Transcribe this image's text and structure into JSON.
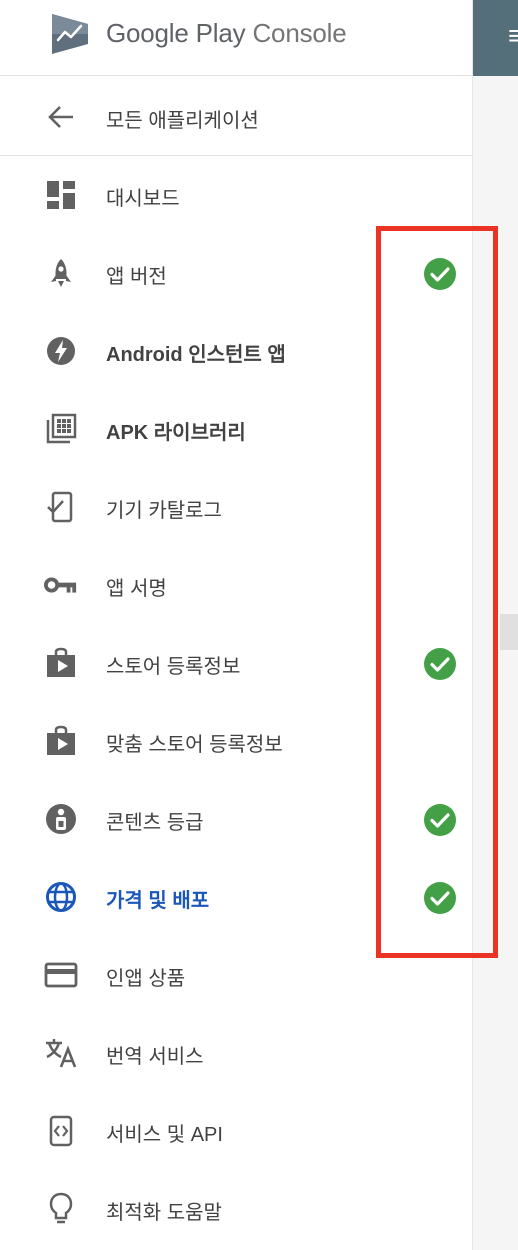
{
  "brand": {
    "name_main": "Google Play",
    "name_sub": "Console"
  },
  "back_link": {
    "label": "모든 애플리케이션",
    "icon": "arrow-left-icon"
  },
  "menu": [
    {
      "label": "대시보드",
      "icon": "dashboard-icon",
      "checked": false,
      "active": false
    },
    {
      "label": "앱 버전",
      "icon": "rocket-icon",
      "checked": true,
      "active": false
    },
    {
      "label": "Android 인스턴트 앱",
      "icon": "instant-app-icon",
      "checked": false,
      "active": false
    },
    {
      "label": "APK 라이브러리",
      "icon": "apk-library-icon",
      "checked": false,
      "active": false
    },
    {
      "label": "기기 카탈로그",
      "icon": "device-catalog-icon",
      "checked": false,
      "active": false
    },
    {
      "label": "앱 서명",
      "icon": "key-icon",
      "checked": false,
      "active": false
    },
    {
      "label": "스토어 등록정보",
      "icon": "store-listing-icon",
      "checked": true,
      "active": false
    },
    {
      "label": "맞춤 스토어 등록정보",
      "icon": "custom-store-listing-icon",
      "checked": false,
      "active": false
    },
    {
      "label": "콘텐츠 등급",
      "icon": "content-rating-icon",
      "checked": true,
      "active": false
    },
    {
      "label": "가격 및 배포",
      "icon": "globe-icon",
      "checked": true,
      "active": true
    },
    {
      "label": "인앱 상품",
      "icon": "credit-card-icon",
      "checked": false,
      "active": false
    },
    {
      "label": "번역 서비스",
      "icon": "translate-icon",
      "checked": false,
      "active": false
    },
    {
      "label": "서비스 및 API",
      "icon": "api-icon",
      "checked": false,
      "active": false
    },
    {
      "label": "최적화 도움말",
      "icon": "lightbulb-icon",
      "checked": false,
      "active": false
    }
  ],
  "colors": {
    "active": "#1a57b8",
    "check": "#43a047",
    "highlight": "#ea3323",
    "topbar": "#546e7a"
  }
}
